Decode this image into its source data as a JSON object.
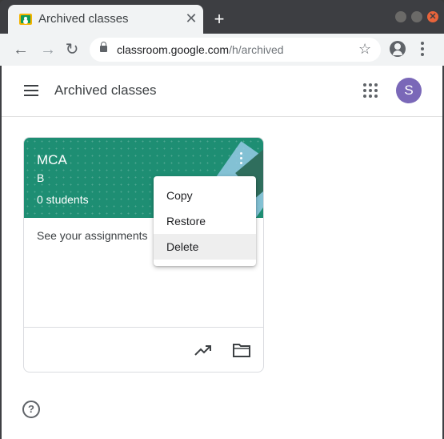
{
  "browser": {
    "tab": {
      "title": "Archived classes",
      "close_glyph": "✕",
      "favicon": "classroom-icon"
    },
    "new_tab_glyph": "+",
    "window_close_glyph": "✕",
    "url": {
      "host": "classroom.google.com",
      "path": "/h/archived"
    },
    "nav": {
      "back_glyph": "←",
      "forward_glyph": "→",
      "reload_glyph": "↻",
      "star_glyph": "☆"
    }
  },
  "appbar": {
    "title": "Archived classes",
    "avatar_letter": "S"
  },
  "card": {
    "class_name": "MCA",
    "section": "B",
    "students": "0 students",
    "assignments": "See your assignments",
    "header_color": "#1e8e73"
  },
  "menu": {
    "items": [
      {
        "label": "Copy"
      },
      {
        "label": "Restore"
      },
      {
        "label": "Delete",
        "hovered": true
      }
    ]
  },
  "help": {
    "glyph": "?"
  }
}
